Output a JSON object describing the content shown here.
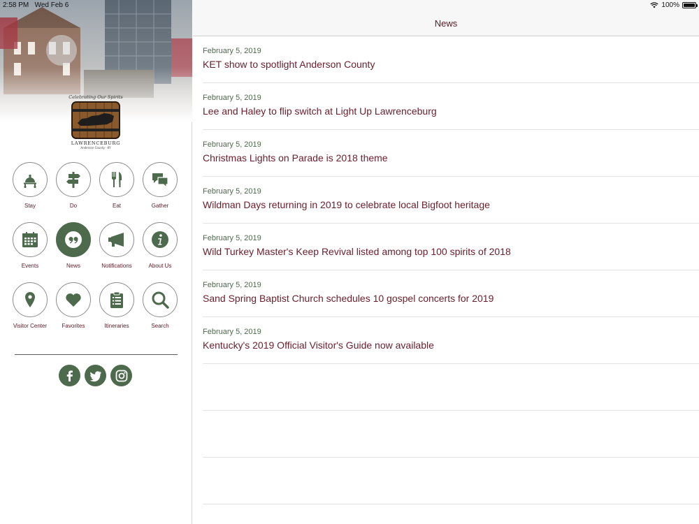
{
  "status_bar": {
    "time": "2:58 PM",
    "date": "Wed Feb 6",
    "battery": "100%",
    "battery_level": 1.0
  },
  "sidebar": {
    "logo": {
      "tagline": "Celebrating Our Spirits",
      "name": "LAWRENCEBURG",
      "subtitle": "Anderson County · KY"
    },
    "nav_items": [
      {
        "label": "Stay",
        "icon": "bell-cart-icon",
        "active": false
      },
      {
        "label": "Do",
        "icon": "signpost-icon",
        "active": false
      },
      {
        "label": "Eat",
        "icon": "utensils-icon",
        "active": false
      },
      {
        "label": "Gather",
        "icon": "chat-bubbles-icon",
        "active": false
      },
      {
        "label": "Events",
        "icon": "calendar-icon",
        "active": false
      },
      {
        "label": "News",
        "icon": "quote-icon",
        "active": true
      },
      {
        "label": "Notifications",
        "icon": "megaphone-icon",
        "active": false
      },
      {
        "label": "About Us",
        "icon": "info-icon",
        "active": false
      },
      {
        "label": "Visitor Center",
        "icon": "map-pin-icon",
        "active": false
      },
      {
        "label": "Favorites",
        "icon": "heart-icon",
        "active": false
      },
      {
        "label": "Itineraries",
        "icon": "clipboard-icon",
        "active": false
      },
      {
        "label": "Search",
        "icon": "search-icon",
        "active": false
      }
    ],
    "social": [
      {
        "name": "facebook",
        "icon": "facebook-icon"
      },
      {
        "name": "twitter",
        "icon": "twitter-icon"
      },
      {
        "name": "instagram",
        "icon": "instagram-icon"
      }
    ],
    "accent_color": "#4e6a4c"
  },
  "header": {
    "title": "News"
  },
  "news": [
    {
      "date": "February 5, 2019",
      "title": "KET show to spotlight Anderson County"
    },
    {
      "date": "February 5, 2019",
      "title": "Lee and Haley to flip switch at Light Up Lawrenceburg"
    },
    {
      "date": "February 5, 2019",
      "title": "Christmas Lights on Parade is 2018 theme"
    },
    {
      "date": "February 5, 2019",
      "title": "Wildman Days returning in 2019 to celebrate local Bigfoot heritage"
    },
    {
      "date": "February 5, 2019",
      "title": "Wild Turkey Master's Keep Revival listed among top 100 spirits of 2018"
    },
    {
      "date": "February 5, 2019",
      "title": "Sand Spring Baptist Church schedules 10 gospel concerts for 2019"
    },
    {
      "date": "February 5, 2019",
      "title": "Kentucky's 2019 Official Visitor's Guide now available"
    }
  ],
  "colors": {
    "title_text": "#6b1d2b",
    "date_text": "#4e6a4c"
  }
}
